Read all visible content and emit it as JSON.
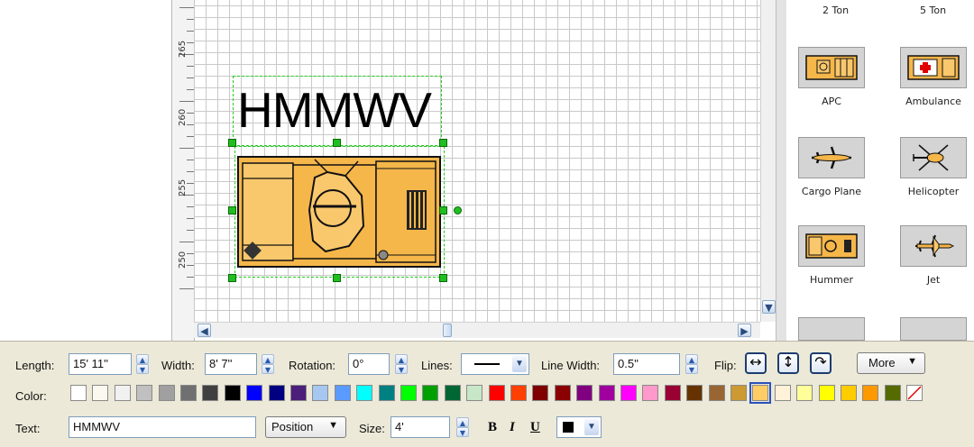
{
  "ruler": {
    "labels": [
      "265",
      "260",
      "255",
      "250"
    ]
  },
  "canvas": {
    "text_object": "HMMWV"
  },
  "palette": {
    "top_labels": [
      "2 Ton",
      "5 Ton"
    ],
    "items": [
      {
        "label": "APC",
        "icon": "apc-icon"
      },
      {
        "label": "Ambulance",
        "icon": "ambulance-icon"
      },
      {
        "label": "Cargo Plane",
        "icon": "cargo-plane-icon"
      },
      {
        "label": "Helicopter",
        "icon": "helicopter-icon"
      },
      {
        "label": "Hummer",
        "icon": "hummer-icon"
      },
      {
        "label": "Jet",
        "icon": "jet-icon"
      }
    ]
  },
  "toolbar": {
    "length_label": "Length:",
    "length_value": "15' 11''",
    "width_label": "Width:",
    "width_value": "8' 7''",
    "rotation_label": "Rotation:",
    "rotation_value": "0°",
    "lines_label": "Lines:",
    "line_width_label": "Line Width:",
    "line_width_value": "0.5''",
    "flip_label": "Flip:",
    "more_label": "More",
    "color_label": "Color:",
    "text_label": "Text:",
    "text_value": "HMMWV",
    "position_label": "Position",
    "size_label": "Size:",
    "size_value": "4'",
    "bold_label": "B",
    "italic_label": "I",
    "underline_label": "U",
    "font_color": "#000000",
    "selected_color": "#ffcc66",
    "colors": [
      "#ffffff",
      "#fbf8f0",
      "#f1f1f1",
      "#c0c0c0",
      "#a0a0a0",
      "#707070",
      "#404040",
      "#000000",
      "#0000ff",
      "#000080",
      "#4b1f7a",
      "#a6c8f0",
      "#5b9bff",
      "#00ffff",
      "#008080",
      "#00ff00",
      "#00a000",
      "#006633",
      "#c8e6c8",
      "#ff0000",
      "#ff4000",
      "#800000",
      "#8b0000",
      "#800080",
      "#a000a0",
      "#ff00ff",
      "#ff99cc",
      "#990033",
      "#663300",
      "#996633",
      "#cc9933",
      "#ffcc66",
      "#fff2d9",
      "#ffff99",
      "#ffff00",
      "#ffcc00",
      "#ff9900",
      "#556b00",
      "none"
    ]
  }
}
